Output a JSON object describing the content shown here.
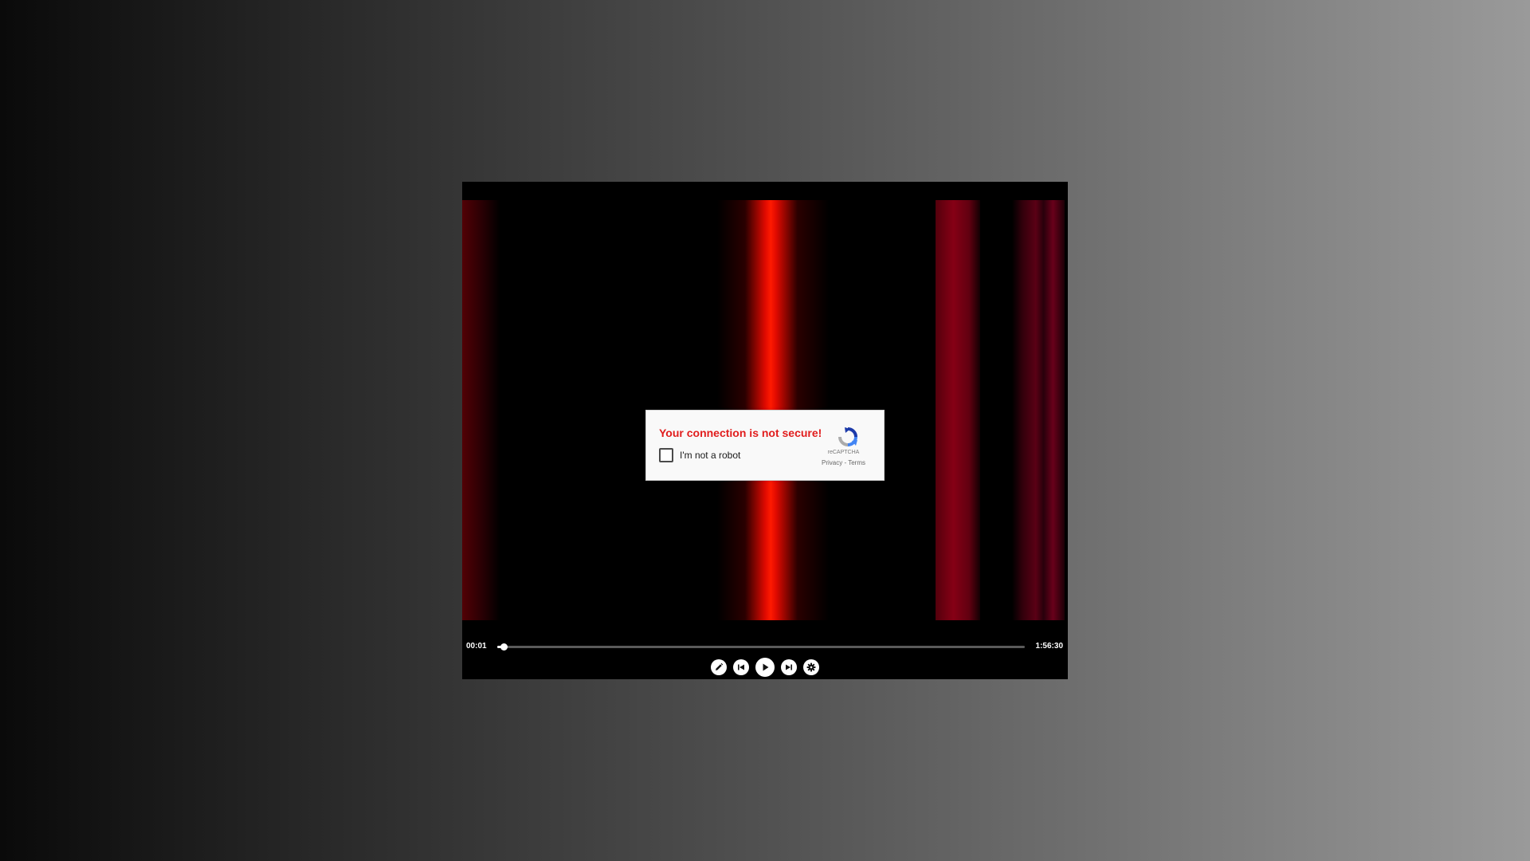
{
  "player": {
    "current_time": "00:01",
    "total_time": "1:56:30",
    "progress": 0.012,
    "controls": [
      {
        "name": "edit-icon"
      },
      {
        "name": "skip-previous-icon"
      },
      {
        "name": "play-icon"
      },
      {
        "name": "skip-next-icon"
      },
      {
        "name": "gear-icon"
      }
    ]
  },
  "captcha": {
    "warning": "Your connection is not secure!",
    "checkbox_label": "I'm not a robot",
    "brand": "reCAPTCHA",
    "privacy_link": "Privacy",
    "separator": " - ",
    "terms_link": "Terms",
    "warning_color": "#e11d1d"
  }
}
